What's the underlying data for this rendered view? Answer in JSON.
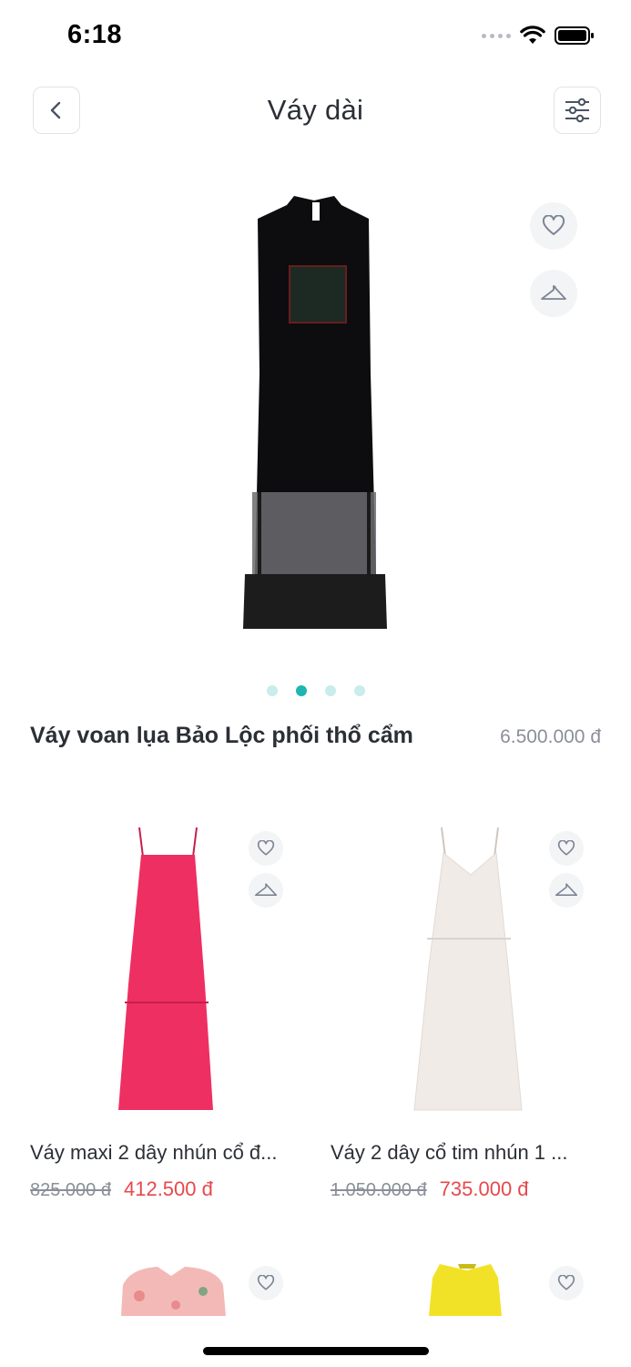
{
  "status_bar": {
    "time": "6:18"
  },
  "header": {
    "title": "Váy dài"
  },
  "featured": {
    "name": "Váy voan lụa Bảo Lộc phối thổ cẩm",
    "price": "6.500.000 đ",
    "carousel_active_index": 1,
    "carousel_count": 4
  },
  "products": [
    {
      "name": "Váy maxi 2 dây nhún cổ đ...",
      "old_price": "825.000 đ",
      "price": "412.500 đ",
      "color": "#ee2f61"
    },
    {
      "name": "Váy 2 dây cổ tim nhún 1 ...",
      "old_price": "1.050.000 đ",
      "price": "735.000 đ",
      "color": "#f1ebe7"
    },
    {
      "name": "",
      "old_price": "",
      "price": "",
      "color": "#f3b9b7"
    },
    {
      "name": "",
      "old_price": "",
      "price": "",
      "color": "#f2e227"
    }
  ],
  "colors": {
    "accent": "#1fb5b0",
    "sale": "#e8484b",
    "muted": "#8a8f98"
  }
}
